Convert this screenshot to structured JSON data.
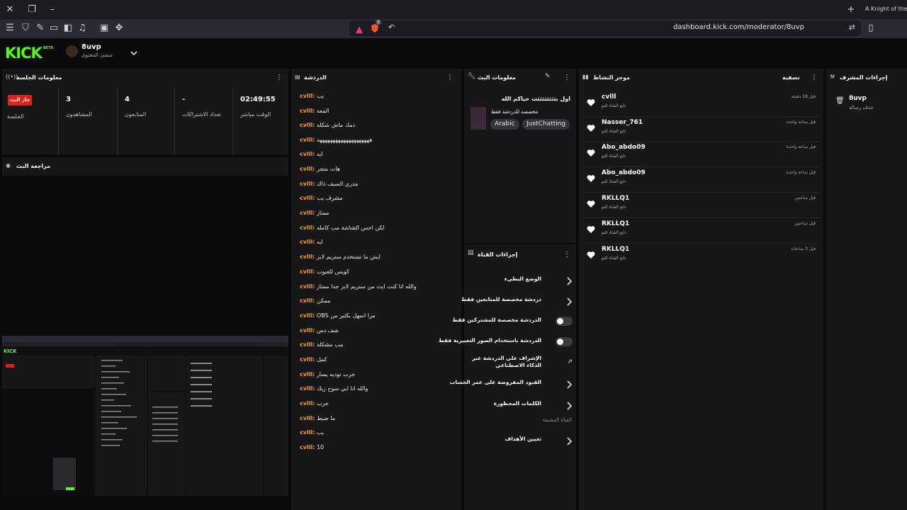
{
  "browser": {
    "tab_title": "A Knight of the S",
    "url": "dashboard.kick.com/moderator/8uvp",
    "shield_badge": "3"
  },
  "kick": {
    "logo": "KICK",
    "beta": "BETA",
    "channel_name": "8uvp",
    "channel_role": "منشئ المحتوى"
  },
  "session": {
    "title": "معلومات الجلسة",
    "live_badge": "جار البث",
    "live_label": "الجلسة",
    "stats": [
      {
        "value": "3",
        "label": "المشاهدون"
      },
      {
        "value": "4",
        "label": "المتابعون"
      },
      {
        "value": "-",
        "label": "تعداد الاشتراكات"
      },
      {
        "value": "02:49:55",
        "label": "الوقت مباشر"
      }
    ]
  },
  "stream_review": {
    "title": "مراجعة البث"
  },
  "chat": {
    "title": "الدردشة",
    "messages": [
      {
        "user": "cvlll:",
        "text": "يب"
      },
      {
        "user": "cvlll:",
        "text": "المعه"
      },
      {
        "user": "cvlll:",
        "text": "دمك ماش شكله"
      },
      {
        "user": "cvlll:",
        "text": "ههههههههههههههههههههه"
      },
      {
        "user": "cvlll:",
        "text": "ايه"
      },
      {
        "user": "cvlll:",
        "text": "هات متجر"
      },
      {
        "user": "cvlll:",
        "text": "مدري السيف ذاك"
      },
      {
        "user": "cvlll:",
        "text": "مشرف يب"
      },
      {
        "user": "cvlll:",
        "text": "ممتاز"
      },
      {
        "user": "cvlll:",
        "text": "لكن احس الشاشة مب كامله"
      },
      {
        "user": "cvlll:",
        "text": "ايه"
      },
      {
        "user": "cvlll:",
        "text": "ايش ما تستخدم ستريم لابز"
      },
      {
        "user": "cvlll:",
        "text": "كويس للعيوب"
      },
      {
        "user": "cvlll:",
        "text": "والله انا كنت ابث من ستريم لابز جدا ممتاز"
      },
      {
        "user": "cvlll:",
        "text": "ممكن"
      },
      {
        "user": "cvlll:",
        "text": "OBS مرا اسهل بكثير من"
      },
      {
        "user": "cvlll:",
        "text": "شف دس"
      },
      {
        "user": "cvlll:",
        "text": "مب مشكلة"
      },
      {
        "user": "cvlll:",
        "text": "كمل"
      },
      {
        "user": "cvlll:",
        "text": "جرب توديه يسار"
      },
      {
        "user": "cvlll:",
        "text": "والله انا ابي سوح زيك"
      },
      {
        "user": "cvlll:",
        "text": "جرب"
      },
      {
        "user": "cvlll:",
        "text": "ما ضبط"
      },
      {
        "user": "cvlll:",
        "text": "يب"
      },
      {
        "user": "cvlll:",
        "text": "10"
      }
    ]
  },
  "stream_info": {
    "title": "معلومات البث",
    "stream_title": "اول بثثثثثثثثت حياكم الله",
    "category_line": "مخصصة للدردشة فقط",
    "tags": [
      "Arabic",
      "JustChatting"
    ]
  },
  "channel_actions": {
    "title": "إجراءات القناة",
    "items": [
      {
        "label": "الوضع البطيء",
        "kind": "chevron"
      },
      {
        "label": "دردشة مخصصة للمتابعين فقط",
        "kind": "chevron"
      },
      {
        "label": "الدردشة مخصصة للمشتركين فقط",
        "kind": "toggle"
      },
      {
        "label": "الدردشة باستخدام الصور التعبيرية فقط",
        "kind": "toggle"
      },
      {
        "label": "الإشراف على الدردشة عبر الذكاء الاصطناعي",
        "kind": "external"
      },
      {
        "label": "القيود المفروضة على عمر الحساب",
        "kind": "chevron"
      },
      {
        "label": "الكلمات المحظورة",
        "kind": "chevron"
      }
    ],
    "section_label": "القناة المضيفة",
    "target_label": "تعيين الأهداف"
  },
  "activity": {
    "title": "موجز النشاط",
    "filter_label": "تصفية",
    "items": [
      {
        "name": "cvlll",
        "sub": "تابع القناة للتو",
        "time": "قبل 18 دقيقة"
      },
      {
        "name": "Nasser_761",
        "sub": "تابع القناة للتو",
        "time": "قبل ساعة واحده"
      },
      {
        "name": "Abo_abdo09",
        "sub": "تابع القناة للتو",
        "time": "قبل ساعة واحدة"
      },
      {
        "name": "Abo_abdo09",
        "sub": "تابع القناة للتو",
        "time": "قبل ساعة واحدة"
      },
      {
        "name": "RKLLQ1",
        "sub": "تابع القناة للتو",
        "time": "قبل ساعتين"
      },
      {
        "name": "RKLLQ1",
        "sub": "تابع القناة للتو",
        "time": "قبل ساعتين"
      },
      {
        "name": "RKLLQ1",
        "sub": "تابع القناة للتو",
        "time": "قبل 3 ساعات"
      }
    ]
  },
  "moderator_actions": {
    "title": "إجراءات المشرف",
    "user": "8uvp",
    "action": "حذف رسالة"
  },
  "colors": {
    "accent": "#53fc18",
    "live": "#e0201a",
    "chat_user": "#f39a21"
  }
}
